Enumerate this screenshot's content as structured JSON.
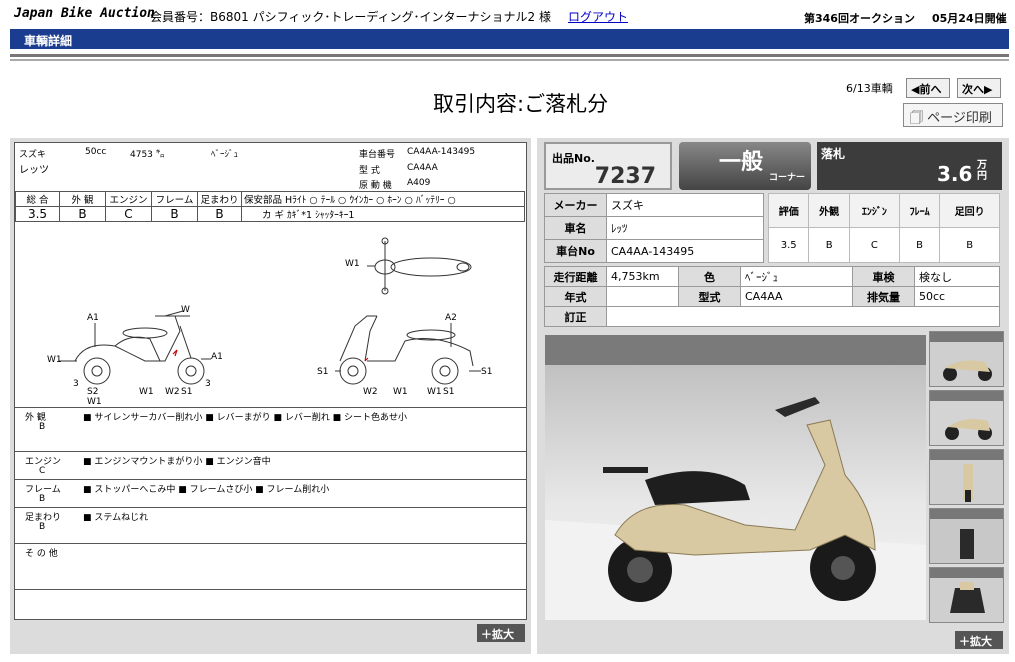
{
  "header": {
    "logo": "Japan Bike Auction",
    "member": "会員番号：B6801 パシフィック･トレーディング･インターナショナル2 様",
    "logout": "ログアウト",
    "auction": "第346回オークション",
    "date": "05月24日開催"
  },
  "bar_title": "車輌詳細",
  "page_title": "取引内容:ご落札分",
  "nav": {
    "count": "6/13車輌",
    "prev": "◀前へ",
    "next": "次へ▶",
    "print": "ページ印刷"
  },
  "sheet": {
    "maker": "スズキ",
    "cc": "50cc",
    "km": "4753 ㌔",
    "color": "ﾍﾞｰｼﾞｭ",
    "model_name": "レッツ",
    "frame_label": "車台番号",
    "frame_no": "CA4AA-143495",
    "type_label": "型 式",
    "type": "CA4AA",
    "engine_label": "原 動 機",
    "engine": "A409",
    "grade_headers": [
      "総 合",
      "外 観",
      "エンジン",
      "フレーム",
      "足まわり"
    ],
    "grades": [
      "3.5",
      "B",
      "C",
      "B",
      "B"
    ],
    "parts_header": "保安部品 Hﾗｲﾄ ○  ﾃｰﾙ ○  ｳｲﾝｶｰ ○  ﾎｰﾝ ○  ﾊﾞｯﾃﾘｰ ○",
    "keys": "カ ギ  ｶｷﾞ*1 ｼｬｯﾀｰｷｰ1",
    "diagram_labels": [
      "W1",
      "A1",
      "W",
      "W1",
      "A1",
      "3",
      "S2",
      "W1",
      "W1",
      "W2",
      "S1",
      "3",
      "A2",
      "S1",
      "W2",
      "W1",
      "W1",
      "S1",
      "S1"
    ],
    "sections": [
      {
        "name": "外 観",
        "grade": "B",
        "items": "■ サイレンサーカバー削れ小 ■ レバーまがり ■ レバー削れ ■ シート色あせ小"
      },
      {
        "name": "エンジン",
        "grade": "C",
        "items": "■ エンジンマウントまがり小 ■ エンジン音中"
      },
      {
        "name": "フレーム",
        "grade": "B",
        "items": "■ ストッパーへこみ中 ■ フレームさび小 ■ フレーム削れ小"
      },
      {
        "name": "足まわり",
        "grade": "B",
        "items": "■ ステムねじれ"
      },
      {
        "name": "そ の 他",
        "grade": "",
        "items": ""
      }
    ],
    "enlarge": "＋拡大"
  },
  "right": {
    "lot_label": "出品No.",
    "lot_no": "7237",
    "corner_big": "一般",
    "corner_small": "コーナー",
    "price_label": "落札",
    "price": "3.6",
    "price_unit": "万円",
    "specs1": [
      {
        "label": "メーカー",
        "value": "スズキ"
      },
      {
        "label": "車名",
        "value": "ﾚｯﾂ"
      },
      {
        "label": "車台No",
        "value": "CA4AA-143495"
      }
    ],
    "grade_headers": [
      "評価",
      "外観",
      "ｴﾝｼﾞﾝ",
      "ﾌﾚｰﾑ",
      "足回り"
    ],
    "grades": [
      "3.5",
      "B",
      "C",
      "B",
      "B"
    ],
    "specs2": {
      "mileage_label": "走行距離",
      "mileage": "4,753km",
      "color_label": "色",
      "color": "ﾍﾞｰｼﾞｭ",
      "inspection_label": "車検",
      "inspection": "検なし",
      "year_label": "年式",
      "year": "",
      "model_label": "型式",
      "model": "CA4AA",
      "displacement_label": "排気量",
      "displacement": "50cc",
      "revised_label": "訂正",
      "revised": ""
    },
    "enlarge": "＋拡大"
  },
  "colors": {
    "bar": "#1b3d8f",
    "link": "#0000c8",
    "scooter": "#d8c9a3"
  }
}
